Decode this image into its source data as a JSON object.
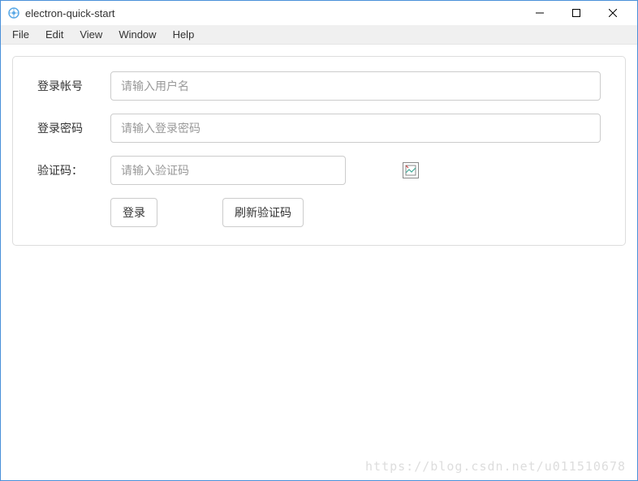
{
  "window": {
    "title": "electron-quick-start"
  },
  "menubar": {
    "items": [
      "File",
      "Edit",
      "View",
      "Window",
      "Help"
    ]
  },
  "form": {
    "username": {
      "label": "登录帐号",
      "placeholder": "请输入用户名",
      "value": ""
    },
    "password": {
      "label": "登录密码",
      "placeholder": "请输入登录密码",
      "value": ""
    },
    "captcha": {
      "label": "验证码：",
      "placeholder": "请输入验证码",
      "value": ""
    },
    "buttons": {
      "login": "登录",
      "refresh_captcha": "刷新验证码"
    }
  },
  "watermark": "https://blog.csdn.net/u011510678"
}
